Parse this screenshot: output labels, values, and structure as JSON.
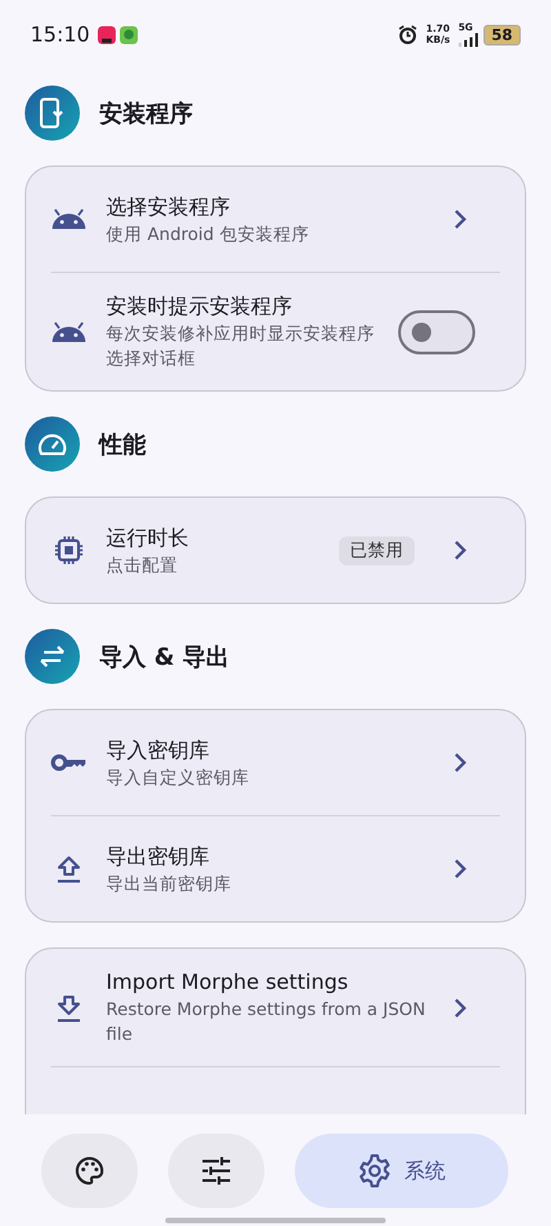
{
  "status_bar": {
    "time": "15:10",
    "network_speed": "1.70",
    "network_unit": "KB/s",
    "network_type": "5G",
    "battery": "58"
  },
  "sections": [
    {
      "title": "安装程序",
      "cards": [
        {
          "items": [
            {
              "kind": "link",
              "title": "选择安装程序",
              "subtitle": "使用 Android 包安装程序"
            },
            {
              "kind": "toggle",
              "title": "安装时提示安装程序",
              "subtitle": "每次安装修补应用时显示安装程序选择对话框",
              "on": false
            }
          ]
        }
      ]
    },
    {
      "title": "性能",
      "cards": [
        {
          "items": [
            {
              "kind": "link",
              "title": "运行时长",
              "subtitle": "点击配置",
              "badge": "已禁用"
            }
          ]
        }
      ]
    },
    {
      "title": "导入 & 导出",
      "cards": [
        {
          "items": [
            {
              "kind": "link",
              "title": "导入密钥库",
              "subtitle": "导入自定义密钥库"
            },
            {
              "kind": "link",
              "title": "导出密钥库",
              "subtitle": "导出当前密钥库"
            }
          ]
        },
        {
          "items": [
            {
              "kind": "link",
              "title": "Import Morphe settings",
              "subtitle": "Restore Morphe settings from a JSON file"
            }
          ]
        }
      ]
    }
  ],
  "nav": [
    {
      "selected": false
    },
    {
      "selected": false
    },
    {
      "label": "系统",
      "selected": true
    }
  ]
}
